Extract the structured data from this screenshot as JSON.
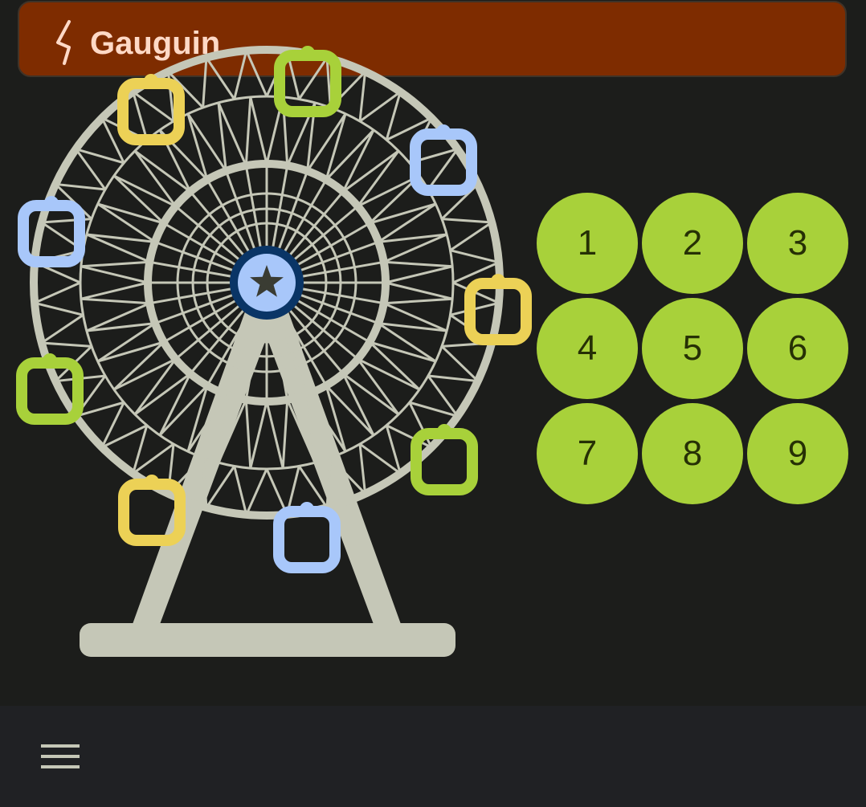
{
  "app": {
    "title": "Gauguin",
    "logo_icon": "gauguin-logo-icon"
  },
  "colors": {
    "background": "#1c1d1b",
    "title_bar": "#7e2c00",
    "title_text": "#ffd9c6",
    "key_fill": "#a8d13a",
    "key_text": "#263005",
    "wheel_frame": "#c5c7b7",
    "hub": "#0a3566",
    "hub_inner": "#a8c7fa",
    "gondola_yellow": "#ecd156",
    "gondola_green": "#a8d13a",
    "gondola_blue": "#a8c7fa",
    "bottom_bar": "#202124"
  },
  "illustration": {
    "name": "ferris-wheel",
    "hub_icon": "star-icon",
    "gondola_colors": [
      "green",
      "blue",
      "yellow",
      "green",
      "blue",
      "yellow",
      "blue",
      "green",
      "yellow",
      "blue",
      "green",
      "yellow"
    ]
  },
  "keypad": {
    "keys": [
      "1",
      "2",
      "3",
      "4",
      "5",
      "6",
      "7",
      "8",
      "9"
    ]
  },
  "bottom_bar": {
    "menu_icon": "menu-icon"
  }
}
